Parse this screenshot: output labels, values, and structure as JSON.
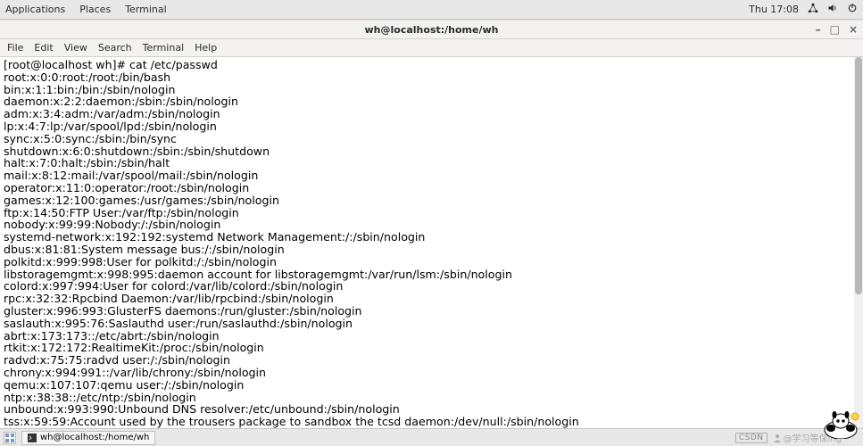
{
  "top_panel": {
    "menu": [
      "Applications",
      "Places",
      "Terminal"
    ],
    "clock": "Thu 17:08"
  },
  "window": {
    "title": "wh@localhost:/home/wh"
  },
  "menubar": [
    "File",
    "Edit",
    "View",
    "Search",
    "Terminal",
    "Help"
  ],
  "terminal": {
    "prompt": "[root@localhost wh]# ",
    "command": "cat /etc/passwd",
    "lines": [
      "root:x:0:0:root:/root:/bin/bash",
      "bin:x:1:1:bin:/bin:/sbin/nologin",
      "daemon:x:2:2:daemon:/sbin:/sbin/nologin",
      "adm:x:3:4:adm:/var/adm:/sbin/nologin",
      "lp:x:4:7:lp:/var/spool/lpd:/sbin/nologin",
      "sync:x:5:0:sync:/sbin:/bin/sync",
      "shutdown:x:6:0:shutdown:/sbin:/sbin/shutdown",
      "halt:x:7:0:halt:/sbin:/sbin/halt",
      "mail:x:8:12:mail:/var/spool/mail:/sbin/nologin",
      "operator:x:11:0:operator:/root:/sbin/nologin",
      "games:x:12:100:games:/usr/games:/sbin/nologin",
      "ftp:x:14:50:FTP User:/var/ftp:/sbin/nologin",
      "nobody:x:99:99:Nobody:/:/sbin/nologin",
      "systemd-network:x:192:192:systemd Network Management:/:/sbin/nologin",
      "dbus:x:81:81:System message bus:/:/sbin/nologin",
      "polkitd:x:999:998:User for polkitd:/:/sbin/nologin",
      "libstoragemgmt:x:998:995:daemon account for libstoragemgmt:/var/run/lsm:/sbin/nologin",
      "colord:x:997:994:User for colord:/var/lib/colord:/sbin/nologin",
      "rpc:x:32:32:Rpcbind Daemon:/var/lib/rpcbind:/sbin/nologin",
      "gluster:x:996:993:GlusterFS daemons:/run/gluster:/sbin/nologin",
      "saslauth:x:995:76:Saslauthd user:/run/saslauthd:/sbin/nologin",
      "abrt:x:173:173::/etc/abrt:/sbin/nologin",
      "rtkit:x:172:172:RealtimeKit:/proc:/sbin/nologin",
      "radvd:x:75:75:radvd user:/:/sbin/nologin",
      "chrony:x:994:991::/var/lib/chrony:/sbin/nologin",
      "qemu:x:107:107:qemu user:/:/sbin/nologin",
      "ntp:x:38:38::/etc/ntp:/sbin/nologin",
      "unbound:x:993:990:Unbound DNS resolver:/etc/unbound:/sbin/nologin",
      "tss:x:59:59:Account used by the trousers package to sandbox the tcsd daemon:/dev/null:/sbin/nologin"
    ]
  },
  "taskbar": {
    "task_label": "wh@localhost:/home/wh",
    "csdn": "CSDN",
    "watermark": "@学习等保ing"
  }
}
